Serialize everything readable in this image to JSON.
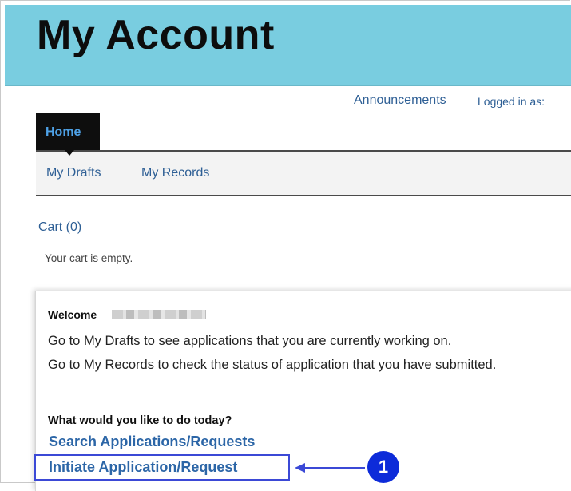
{
  "header": {
    "title": "My Account"
  },
  "top_links": {
    "announcements": "Announcements",
    "logged_in_as": "Logged in as:"
  },
  "tabs": {
    "home": "Home"
  },
  "subnav": {
    "my_drafts": "My Drafts",
    "my_records": "My Records"
  },
  "cart": {
    "title": "Cart (0)",
    "empty_message": "Your cart is empty."
  },
  "welcome": {
    "label": "Welcome",
    "line1": "Go to My Drafts to see applications that you are currently working on.",
    "line2": "Go to My Records to check the status of application that you have submitted."
  },
  "actions": {
    "question": "What would you like to do today?",
    "search": "Search Applications/Requests",
    "initiate": "Initiate Application/Request"
  },
  "annotation": {
    "callout_number": "1",
    "color": "#0d2bd9"
  }
}
